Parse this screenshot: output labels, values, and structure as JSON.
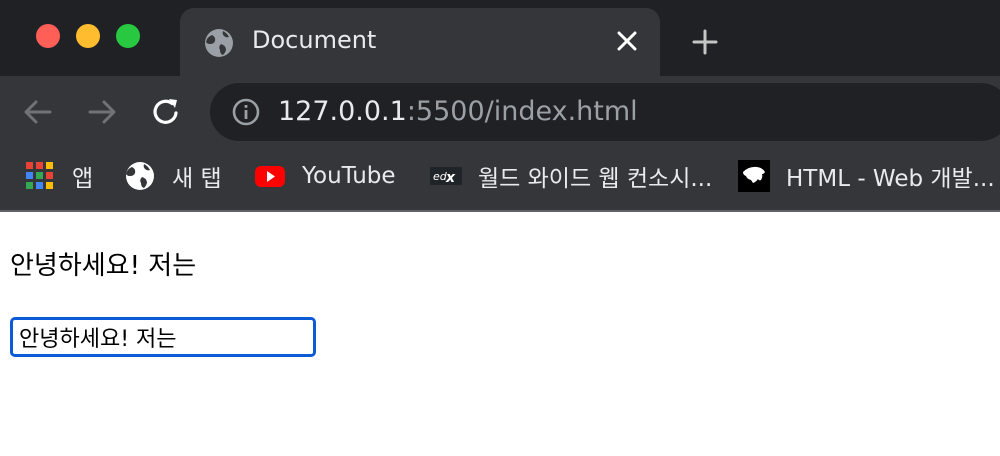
{
  "browser": {
    "tab": {
      "title": "Document"
    },
    "address": {
      "host": "127.0.0.1",
      "path": ":5500/index.html"
    },
    "bookmarks": [
      {
        "label": "앱",
        "icon": "apps-grid-icon"
      },
      {
        "label": "새 탭",
        "icon": "globe-icon"
      },
      {
        "label": "YouTube",
        "icon": "youtube-icon"
      },
      {
        "label": "월드 와이드 웹 컨소시...",
        "icon": "edx-icon"
      },
      {
        "label": "HTML - Web 개발...",
        "icon": "mdn-icon"
      }
    ]
  },
  "page": {
    "greeting": "안녕하세요! 저는",
    "input": {
      "value": "안녕하세요! 저는"
    }
  },
  "colors": {
    "chrome_dark": "#202124",
    "chrome_toolbar": "#35363a",
    "input_focus": "#0c5bd6"
  }
}
